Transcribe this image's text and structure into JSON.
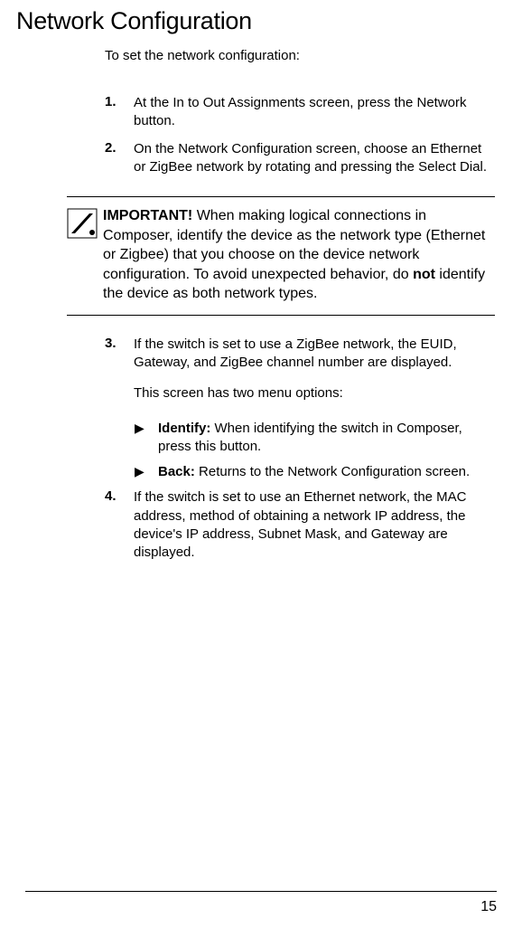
{
  "heading": "Network Configuration",
  "intro": "To set the network configuration:",
  "steps": {
    "s1": {
      "num": "1.",
      "body": "At the In to Out Assignments screen, press the Network button."
    },
    "s2": {
      "num": "2.",
      "body": "On the Network Configuration screen, choose an Ethernet or ZigBee network by rotating and pressing the Select Dial."
    },
    "s3": {
      "num": "3.",
      "body": "If the switch is set to use a ZigBee network, the EUID, Gateway, and ZigBee channel number are displayed.",
      "sub": "This screen has two menu options:"
    },
    "s4": {
      "num": "4.",
      "body": "If the switch is set to use an Ethernet network, the MAC address, method of obtaining a network IP address, the device's IP address, Subnet Mask, and Gateway are displayed."
    }
  },
  "important": {
    "label": "IMPORTANT!",
    "text_a": " When making logical connections in Composer, identify the device as the network type (Ethernet or Zigbee) that you choose on the device network configuration. To avoid unexpected behavior, do ",
    "not": "not",
    "text_b": " identify the device as both network types."
  },
  "bullets": {
    "b1": {
      "label": "Identify:",
      "rest": " When identifying the switch in Composer, press this button."
    },
    "b2": {
      "label": "Back:",
      "rest": " Returns to the Network Configuration screen."
    }
  },
  "page_number": "15"
}
